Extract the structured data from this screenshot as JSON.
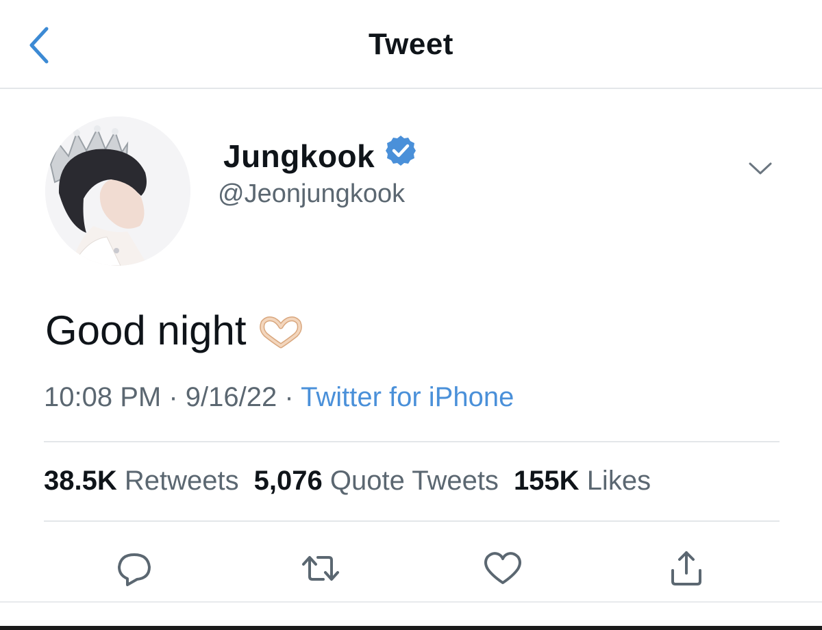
{
  "header": {
    "title": "Tweet",
    "back_icon": "chevron-left-icon"
  },
  "author": {
    "display_name": "Jungkook",
    "handle": "@Jeonjungkook",
    "verified": true,
    "badge_color": "#4a90d9"
  },
  "tweet": {
    "text": "Good night",
    "emoji": "heart-hands-emoji",
    "time": "10:08 PM",
    "date": "9/16/22",
    "separator": "·",
    "source": "Twitter for iPhone"
  },
  "stats": [
    {
      "count": "38.5K",
      "label": "Retweets"
    },
    {
      "count": "5,076",
      "label": "Quote Tweets"
    },
    {
      "count": "155K",
      "label": "Likes"
    }
  ],
  "actions": [
    "reply-icon",
    "retweet-icon",
    "like-icon",
    "share-icon"
  ],
  "colors": {
    "accent": "#4a90d9",
    "secondary_text": "#5b6771",
    "primary_text": "#0f1419",
    "divider": "#e3e6e9"
  }
}
